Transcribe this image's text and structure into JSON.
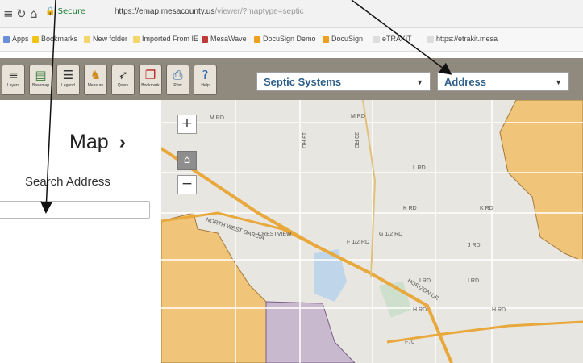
{
  "browser": {
    "secure_label": "Secure",
    "url_host": "https://emap.mesacounty.us",
    "url_path": "/viewer/?maptype=septic"
  },
  "bookmarks": [
    {
      "label": "Apps",
      "color": "#6b8fd6"
    },
    {
      "label": "Bookmarks",
      "color": "#f0c419"
    },
    {
      "label": "New folder",
      "color": "#f5d66b"
    },
    {
      "label": "Imported From IE",
      "color": "#f5d66b"
    },
    {
      "label": "MesaWave",
      "color": "#c23b3b"
    },
    {
      "label": "DocuSign Demo",
      "color": "#f0a020"
    },
    {
      "label": "DocuSign",
      "color": "#f0a020"
    },
    {
      "label": "eTRAKiT",
      "color": "#dddddd"
    },
    {
      "label": "https://etrakit.mesa",
      "color": "#dddddd"
    }
  ],
  "toolbar": {
    "tools": [
      {
        "label": "Layers",
        "icon": "layers-icon",
        "glyph": "≡"
      },
      {
        "label": "Basemap",
        "icon": "basemap-icon",
        "glyph": "▤"
      },
      {
        "label": "Legend",
        "icon": "legend-icon",
        "glyph": "☰"
      },
      {
        "label": "Measure",
        "icon": "measure-icon",
        "glyph": "♞"
      },
      {
        "label": "Query",
        "icon": "query-icon",
        "glyph": "➶"
      },
      {
        "label": "Bookmark",
        "icon": "bookmark-icon",
        "glyph": "❐"
      },
      {
        "label": "Print",
        "icon": "print-icon",
        "glyph": "⎙"
      },
      {
        "label": "Help",
        "icon": "help-icon",
        "glyph": "?"
      }
    ],
    "map_type_select": "Septic Systems",
    "search_type_select": "Address"
  },
  "sidebar": {
    "title": "Map",
    "chevron": "›",
    "search_label": "Search Address",
    "search_value": ""
  },
  "map": {
    "zoom_in": "+",
    "zoom_out": "−",
    "home_glyph": "⌂",
    "labels": [
      "M RD",
      "M RD",
      "L RD",
      "K RD",
      "K RD",
      "I RD",
      "H RD",
      "J RD",
      "19 RD",
      "20 RD",
      "F 1/2 RD",
      "I RD",
      "H RD",
      "HORIZON DR",
      "NORTH WEST GARCIA",
      "I-70",
      "CRESTVIEW",
      "G 1/2 RD"
    ],
    "colors": {
      "terrain": "#f0c57a",
      "federal": "#c8b9cf",
      "park": "#bfd6ea",
      "road": "#e8a83b",
      "base": "#e8e6e1"
    }
  }
}
